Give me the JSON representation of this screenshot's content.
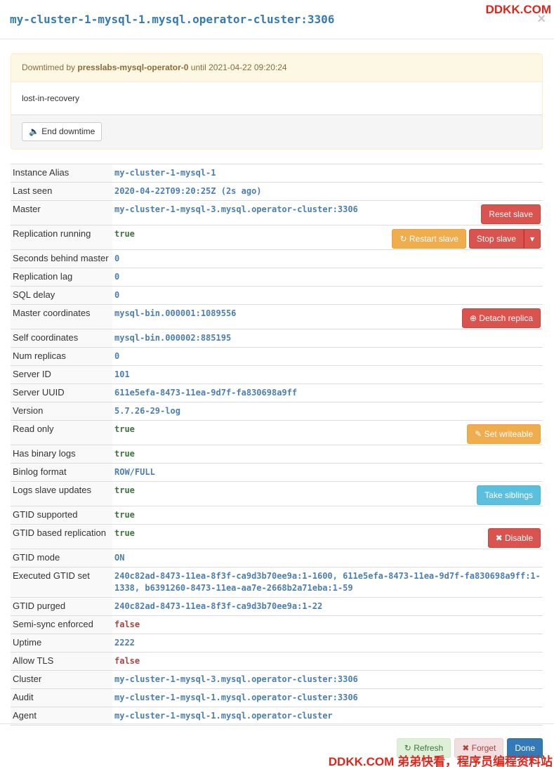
{
  "header": {
    "title": "my-cluster-1-mysql-1.mysql.operator-cluster:3306",
    "close": "×"
  },
  "watermark": {
    "top": "DDKK.COM",
    "bottom": "DDKK.COM 弟弟快看，程序员编程资料站"
  },
  "downtime": {
    "prefix": "Downtimed by",
    "owner": "presslabs-mysql-operator-0",
    "until": "until 2021-04-22 09:20:24",
    "reason": "lost-in-recovery",
    "end_button": "End downtime",
    "end_icon": "🔈"
  },
  "rows": [
    {
      "key": "Instance Alias",
      "value": "my-cluster-1-mysql-1"
    },
    {
      "key": "Last seen",
      "value": "2020-04-22T09:20:25Z (2s ago)"
    },
    {
      "key": "Master",
      "value": "my-cluster-1-mysql-3.mysql.operator-cluster:3306",
      "btn1": "Reset slave"
    },
    {
      "key": "Replication running",
      "value": "true",
      "btn1": "Restart slave",
      "btn2": "Stop slave"
    },
    {
      "key": "Seconds behind master",
      "value": "0"
    },
    {
      "key": "Replication lag",
      "value": "0"
    },
    {
      "key": "SQL delay",
      "value": "0"
    },
    {
      "key": "Master coordinates",
      "value": "mysql-bin.000001:1089556",
      "btn1": "Detach replica"
    },
    {
      "key": "Self coordinates",
      "value": "mysql-bin.000002:885195"
    },
    {
      "key": "Num replicas",
      "value": "0"
    },
    {
      "key": "Server ID",
      "value": "101"
    },
    {
      "key": "Server UUID",
      "value": "611e5efa-8473-11ea-9d7f-fa830698a9ff"
    },
    {
      "key": "Version",
      "value": "5.7.26-29-log"
    },
    {
      "key": "Read only",
      "value": "true",
      "btn1": "Set writeable"
    },
    {
      "key": "Has binary logs",
      "value": "true"
    },
    {
      "key": "Binlog format",
      "value": "ROW/FULL"
    },
    {
      "key": "Logs slave updates",
      "value": "true",
      "btn1": "Take siblings"
    },
    {
      "key": "GTID supported",
      "value": "true"
    },
    {
      "key": "GTID based replication",
      "value": "true",
      "btn1": "Disable"
    },
    {
      "key": "GTID mode",
      "value": "ON"
    },
    {
      "key": "Executed GTID set",
      "value": "240c82ad-8473-11ea-8f3f-ca9d3b70ee9a:1-1600, 611e5efa-8473-11ea-9d7f-fa830698a9ff:1-1338, b6391260-8473-11ea-aa7e-2668b2a71eba:1-59"
    },
    {
      "key": "GTID purged",
      "value": "240c82ad-8473-11ea-8f3f-ca9d3b70ee9a:1-22"
    },
    {
      "key": "Semi-sync enforced",
      "value": "false"
    },
    {
      "key": "Uptime",
      "value": "2222"
    },
    {
      "key": "Allow TLS",
      "value": "false"
    },
    {
      "key": "Cluster",
      "value": "my-cluster-1-mysql-3.mysql.operator-cluster:3306"
    },
    {
      "key": "Audit",
      "value": "my-cluster-1-mysql-1.mysql.operator-cluster:3306"
    },
    {
      "key": "Agent",
      "value": "my-cluster-1-mysql-1.mysql.operator-cluster"
    }
  ],
  "icons": {
    "restart": "↻",
    "detach": "⊕",
    "writeable": "✎",
    "disable": "✖",
    "caret": "▾",
    "refresh": "↻",
    "forget": "✖"
  },
  "footer": {
    "refresh": "Refresh",
    "forget": "Forget",
    "done": "Done"
  },
  "colors": {
    "link": "#337ab7",
    "true": "#3c763d",
    "false": "#a94442",
    "danger": "#d9534f",
    "warning": "#f0ad4e",
    "info": "#5bc0de"
  }
}
